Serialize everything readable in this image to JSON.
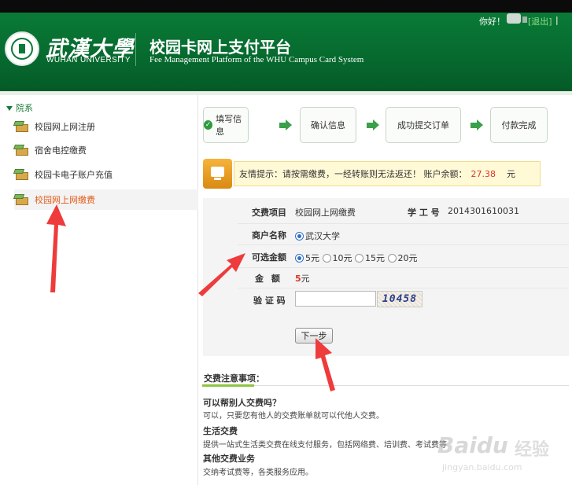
{
  "header": {
    "logo_cn": "武漢大學",
    "logo_en": "WUHAN UNIVERSITY",
    "title": "校园卡网上支付平台",
    "subtitle": "Fee Management Platform of the WHU Campus Card System",
    "greeting": "你好！",
    "logout": "[退出]",
    "extra": "|"
  },
  "sidebar": {
    "heading": "院系",
    "items": [
      {
        "label": "校园网上网注册"
      },
      {
        "label": "宿舍电控缴费"
      },
      {
        "label": "校园卡电子账户充值"
      },
      {
        "label": "校园网上网缴费"
      }
    ]
  },
  "steps": [
    {
      "label": "填写信息"
    },
    {
      "label": "确认信息"
    },
    {
      "label": "成功提交订单"
    },
    {
      "label": "付款完成"
    }
  ],
  "tip": {
    "text": "友情提示：请按需缴费，一经转账则无法返还！ 账户余额：",
    "balance": "27.38",
    "unit": "元"
  },
  "form": {
    "item_label": "交费项目",
    "item_value": "校园网上网缴费",
    "student_label": "学 工 号",
    "student_value": "2014301610031",
    "merchant_label": "商户名称",
    "merchant_value": "武汉大学",
    "options_label": "可选金额",
    "options": [
      "5元",
      "10元",
      "15元",
      "20元"
    ],
    "amount_label": "金 额",
    "amount_value": "5",
    "amount_unit": "元",
    "captcha_label": "验 证 码",
    "captcha_value": "",
    "captcha_code": "10458",
    "next_button": "下一步"
  },
  "notes": {
    "title": "交费注意事项：",
    "items": [
      {
        "q": "可以帮别人交费吗？",
        "a": "可以，只要您有他人的交费账单就可以代他人交费。"
      },
      {
        "q": "生活交费",
        "a": "提供一站式生活类交费在线支付服务，包括网络费、培训费、考试费等"
      },
      {
        "q": "其他交费业务",
        "a": "交纳考试费等，各类服务应用。"
      }
    ]
  },
  "watermark": {
    "logo": "Baidu",
    "cn": "经验",
    "url": "jingyan.baidu.com"
  },
  "colors": {
    "header_green": "#0a7a37",
    "accent_orange": "#e55b1a",
    "balance_red": "#d9342b",
    "annotation_arrow": "#ee3b3b"
  }
}
